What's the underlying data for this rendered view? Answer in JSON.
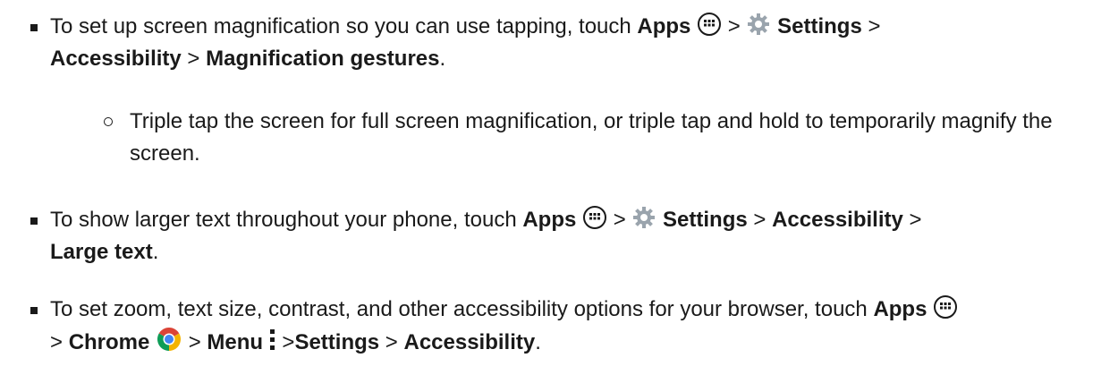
{
  "items": [
    {
      "intro": "To set up screen magnification so you can use tapping, touch",
      "apps": "Apps",
      "sep1": ">",
      "settings": "Settings",
      "sep2": ">",
      "accessibility": "Accessibility",
      "sep3": ">",
      "target": "Magnification gestures",
      "end": "."
    },
    {
      "sub": "Triple tap the screen for full screen magnification, or triple tap and hold to temporarily magnify the screen."
    },
    {
      "intro": "To show larger text throughout your phone, touch",
      "apps": "Apps",
      "sep1": ">",
      "settings": "Settings",
      "sep2": ">",
      "accessibility": "Accessibility",
      "sep3": ">",
      "target": "Large text",
      "end": "."
    },
    {
      "intro": "To set zoom, text size, contrast, and other accessibility options for your browser, touch",
      "apps": "Apps",
      "sep1": ">",
      "chrome": "Chrome",
      "sep2": ">",
      "menu": "Menu",
      "sep3": ">",
      "settings": "Settings",
      "sep4": ">",
      "accessibility": "Accessibility",
      "end": "."
    }
  ],
  "icons": {
    "apps": "apps-icon",
    "settings": "gear-icon",
    "chrome": "chrome-icon",
    "menu": "menu-icon"
  }
}
